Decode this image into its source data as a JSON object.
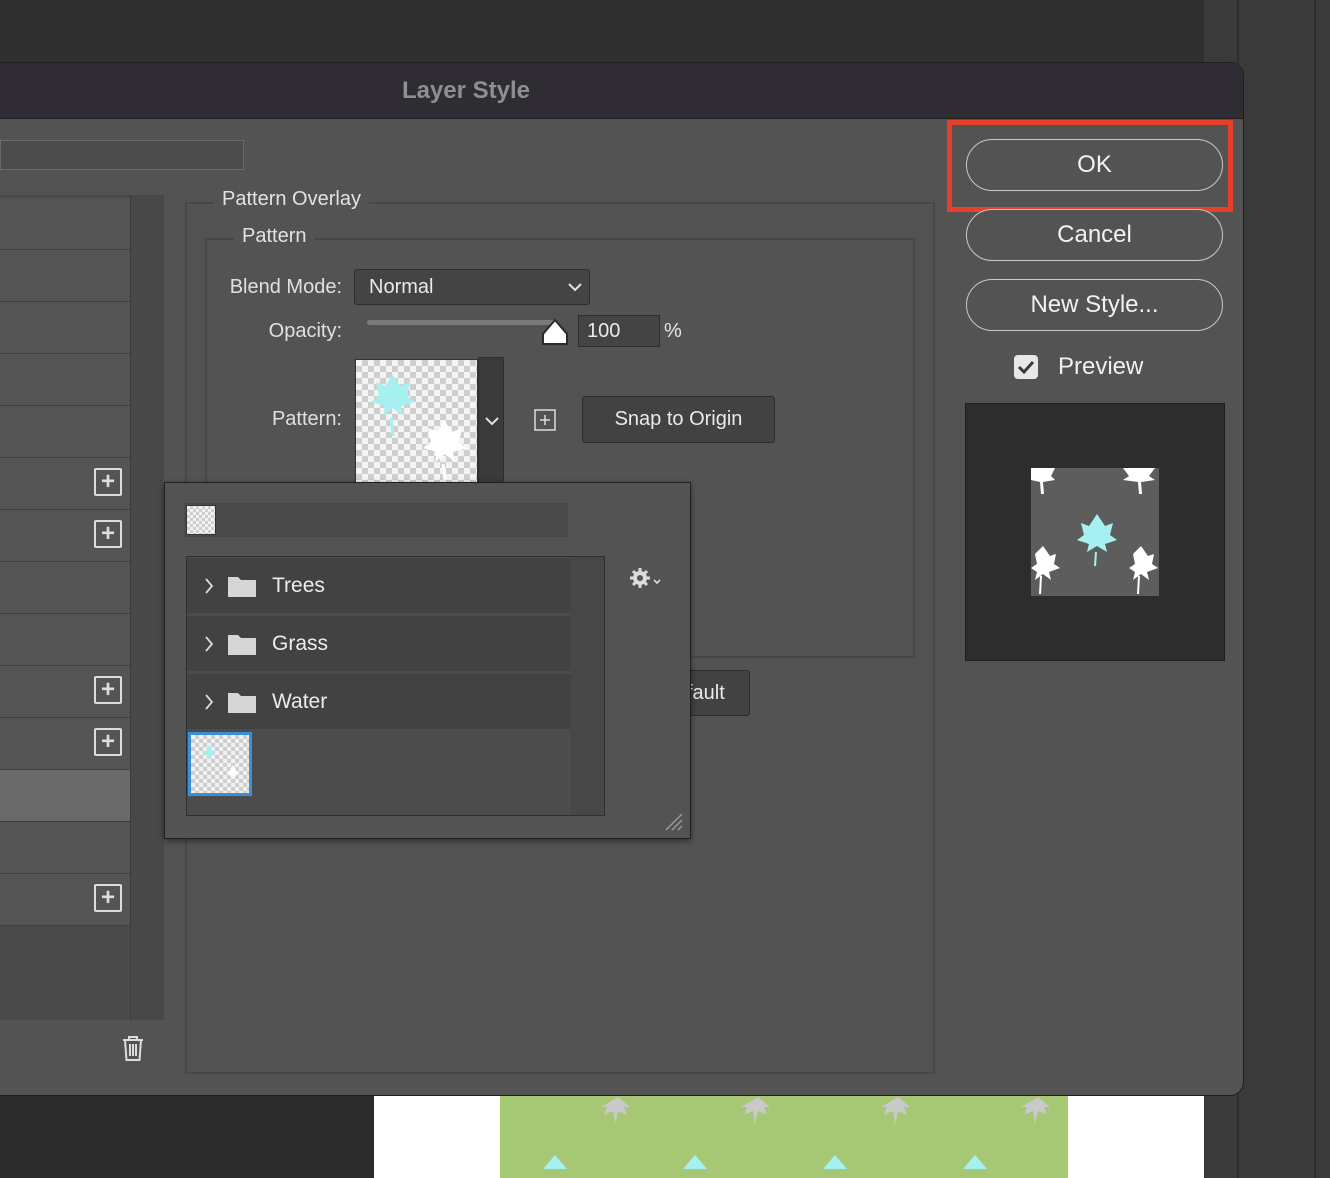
{
  "dialog": {
    "title": "Layer Style"
  },
  "panel": {
    "group_title": "Pattern Overlay",
    "subgroup_title": "Pattern",
    "blend_mode_label": "Blend Mode:",
    "blend_mode_value": "Normal",
    "opacity_label": "Opacity:",
    "opacity_value": "100",
    "opacity_unit": "%",
    "opacity_percent": 100,
    "pattern_label": "Pattern:",
    "snap_label": "Snap to Origin",
    "default_label_partial": "fault"
  },
  "buttons": {
    "ok_label": "OK",
    "cancel_label": "Cancel",
    "new_style_label": "New Style..."
  },
  "preview": {
    "label": "Preview",
    "checked": true
  },
  "picker": {
    "folders": [
      {
        "name": "Trees"
      },
      {
        "name": "Grass"
      },
      {
        "name": "Water"
      }
    ]
  },
  "colors": {
    "highlight": "#e5402a",
    "selection": "#3a8fd9",
    "leaf_cyan": "#a6f0f2",
    "canvas_green": "#a6c874"
  },
  "icons": [
    "chevron-down-icon",
    "new-preset-icon",
    "gear-icon",
    "folder-icon",
    "chevron-right-icon",
    "trash-icon",
    "plus-icon",
    "checkmark-icon",
    "resize-grip-icon"
  ]
}
